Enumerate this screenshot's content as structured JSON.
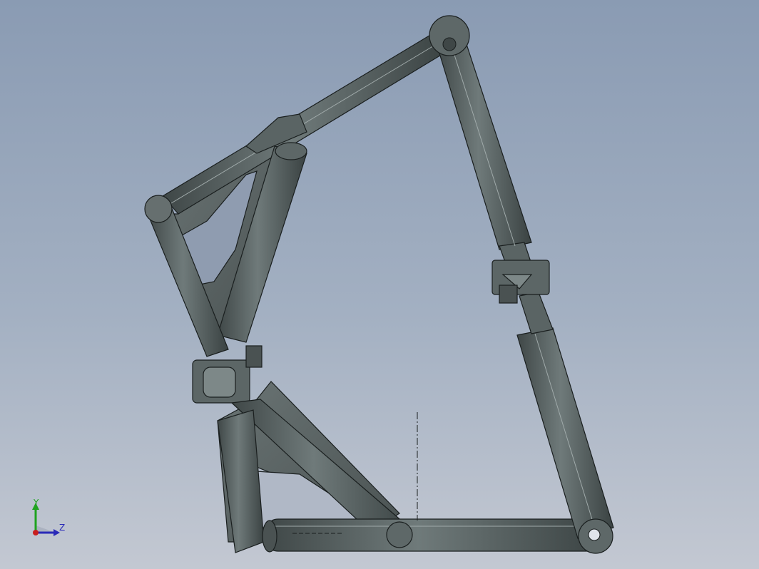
{
  "viewport": {
    "background_top": "#8a9bb3",
    "background_bottom": "#c3c8d2"
  },
  "model": {
    "part_color": "#5f6a6a",
    "edge_color": "#1a1f1f",
    "highlight_color": "#8a9494"
  },
  "triad": {
    "y_label": "Y",
    "z_label": "Z",
    "y_color": "#1fa31f",
    "z_color": "#2a2ab8",
    "x_color": "#c81e1e"
  }
}
